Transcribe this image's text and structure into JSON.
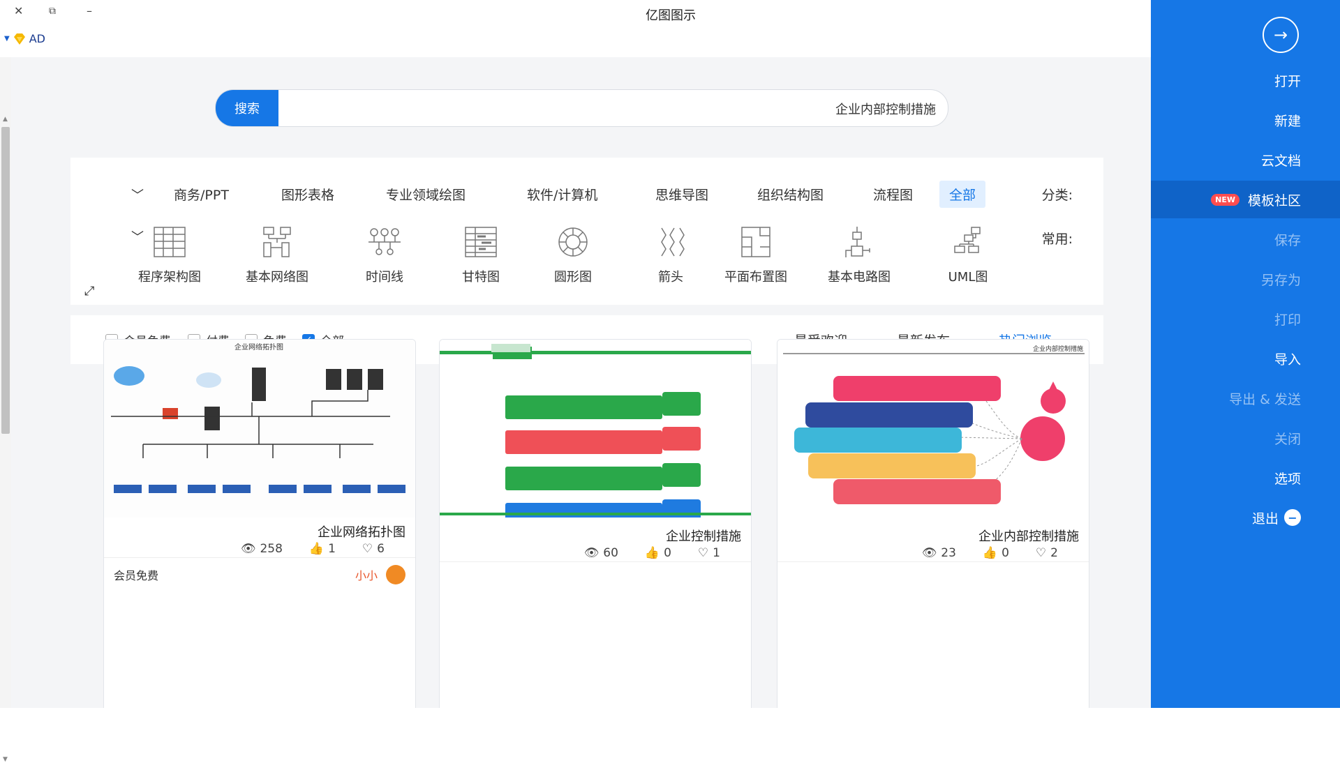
{
  "window": {
    "title": "亿图图示",
    "close": "✕",
    "restore": "⧉",
    "minimize": "–"
  },
  "ad": {
    "label": "AD"
  },
  "search": {
    "button": "搜索",
    "value": "企业内部控制措施"
  },
  "categories": {
    "label": "分类:",
    "items": [
      "全部",
      "流程图",
      "组织结构图",
      "思维导图",
      "软件/计算机",
      "专业领域绘图",
      "图形表格",
      "商务/PPT"
    ]
  },
  "common": {
    "label": "常用:",
    "items": [
      "UML图",
      "基本电路图",
      "平面布置图",
      "箭头",
      "圆形图",
      "甘特图",
      "时间线",
      "基本网络图",
      "程序架构图"
    ]
  },
  "sort": {
    "tabs": [
      "热门浏览",
      "最新发布",
      "最受欢迎"
    ]
  },
  "filters": {
    "options": [
      "全部",
      "免费",
      "付费",
      "会员免费"
    ]
  },
  "cards": [
    {
      "title": "企业网络拓扑图",
      "views": "258",
      "likes": "1",
      "favs": "6",
      "author": "小小",
      "tag": "会员免费",
      "thumb_title": "企业网络拓扑图"
    },
    {
      "title": "企业控制措施",
      "views": "60",
      "likes": "0",
      "favs": "1",
      "thumb_title": ""
    },
    {
      "title": "企业内部控制措施",
      "views": "23",
      "likes": "0",
      "favs": "2",
      "thumb_title": "企业内部控制措施"
    }
  ],
  "sidebar": {
    "items": [
      "打开",
      "新建",
      "云文档",
      "模板社区",
      "保存",
      "另存为",
      "打印",
      "导入",
      "导出 & 发送",
      "关闭",
      "选项",
      "退出"
    ],
    "badge": "NEW"
  },
  "colors": {
    "accent": "#1677e6",
    "sidebar": "#1677e6",
    "badge": "#ff4d4f"
  }
}
